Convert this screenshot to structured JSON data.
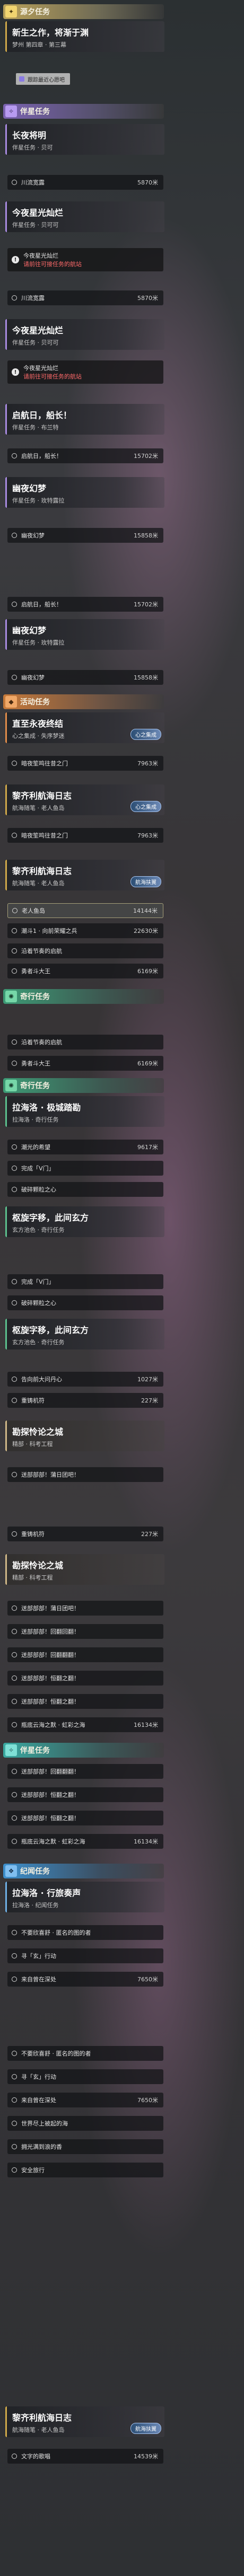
{
  "sections": {
    "s1": "源夕任务",
    "s2": "伴星任务",
    "s3": "活动任务",
    "s4": "奇行任务",
    "s5": "奇行任务",
    "s6": "伴星任务",
    "s7": "伴星任务",
    "s8": "纪闻任务"
  },
  "q1": {
    "title": "新生之作，将渐于渊",
    "sub": "梦州 第四章 · 第三幕",
    "hint": "跟踪最近心愿吧"
  },
  "q2": {
    "title": "长夜将明",
    "sub": "伴星任务 · 贝可"
  },
  "q2o": {
    "text": "川流宽露",
    "dist": "5870米"
  },
  "q3": {
    "title": "今夜星光灿烂",
    "sub": "伴星任务 · 贝可可"
  },
  "q3n": {
    "warn": "!",
    "line1": "今夜星光灿烂",
    "line2": "请前往可接任务的航站"
  },
  "q3o": {
    "text": "川流宽露",
    "dist": "5870米"
  },
  "q4": {
    "title": "今夜星光灿烂",
    "sub": "伴星任务 · 贝可可"
  },
  "q4n": {
    "warn": "!",
    "line1": "今夜星光灿烂",
    "line2": "请前往可接任务的航站"
  },
  "q5": {
    "title": "启航日，船长！",
    "sub": "伴星任务 · 布兰特"
  },
  "q5o": {
    "text": "启航日，船长！",
    "dist": "15702米"
  },
  "q6": {
    "title": "幽夜幻梦",
    "sub": "伴星任务 · 玫特露拉"
  },
  "q6o": {
    "text": "幽夜幻梦",
    "dist": "15858米"
  },
  "q7o": {
    "text": "启航日，船长！",
    "dist": "15702米"
  },
  "q8": {
    "title": "幽夜幻梦",
    "sub": "伴星任务 · 玫特露拉"
  },
  "q8o": {
    "text": "幽夜幻梦",
    "dist": "15858米"
  },
  "q9": {
    "title": "直至永夜终结",
    "sub": "心之集成 · 失序梦迷",
    "badge": "心之集成"
  },
  "q9o": {
    "text": "暗夜笙鸣往昔之门",
    "dist": "7963米"
  },
  "q10": {
    "title": "黎齐利航海日志",
    "sub": "航海随笔 · 老人鱼岛",
    "badge": "心之集成"
  },
  "q10o": {
    "text": "暗夜笙鸣往昔之门",
    "dist": "7963米"
  },
  "q11": {
    "title": "黎齐利航海日志",
    "sub": "航海随笔 · 老人鱼岛",
    "badge": "航海扶翼"
  },
  "q11o1": {
    "text": "老人鱼岛",
    "dist": "14144米"
  },
  "q11o2": {
    "text": "潮斗1 · 向前荣耀之兵",
    "dist": "22630米"
  },
  "q11o3": {
    "text": "沿着节奏的启航",
    "dist": ""
  },
  "q11o4": {
    "text": "勇者斗大王",
    "dist": "6169米"
  },
  "q12o1": {
    "text": "沿着节奏的启航",
    "dist": ""
  },
  "q12o2": {
    "text": "勇者斗大王",
    "dist": "6169米"
  },
  "q13": {
    "title": "拉海洛 · 极城踏勘",
    "sub": "拉海洛 · 奇行任务"
  },
  "q13o1": {
    "text": "潮光的希望",
    "dist": "9617米"
  },
  "q13o2": {
    "text": "完成「V门」",
    "dist": ""
  },
  "q13o3": {
    "text": "破碎颗粒之心",
    "dist": ""
  },
  "q14": {
    "title": "枢旋字移，此间玄方",
    "sub": "玄方池色 · 奇行任务"
  },
  "q14o1": {
    "text": "完成「V门」",
    "dist": ""
  },
  "q14o2": {
    "text": "破碎颗粒之心",
    "dist": ""
  },
  "q15": {
    "title": "枢旋字移，此间玄方",
    "sub": "玄方池色 · 奇行任务"
  },
  "q15o1": {
    "text": "告向前大问丹心",
    "dist": "1027米"
  },
  "q15o2": {
    "text": "重铸机符",
    "dist": "227米"
  },
  "q16": {
    "title": "勘探怜论之城",
    "sub": "精部 · 科考工程"
  },
  "q16o1": {
    "text": "送部部部！蒲日团吧！",
    "dist": ""
  },
  "q16o2": {
    "text": "重铸机符",
    "dist": "227米"
  },
  "q17": {
    "title": "勘探怜论之城",
    "sub": "精部 · 科考工程"
  },
  "q17o1": {
    "text": "送部部部！蒲日团吧！",
    "dist": ""
  },
  "q17o2": {
    "text": "送部部部！回翻回翻！",
    "dist": ""
  },
  "q17o3": {
    "text": "送部部部！回翻翻翻！",
    "dist": ""
  },
  "q17o4": {
    "text": "送部部部！恒翻之翻！",
    "dist": ""
  },
  "q17o5": {
    "text": "送部部部！恒翻之翻！",
    "dist": ""
  },
  "q17o6": {
    "text": "瓶底云海之默 · 虹彩之海",
    "dist": "16134米"
  },
  "q18o1": {
    "text": "送部部部！回翻翻翻！",
    "dist": ""
  },
  "q18o2": {
    "text": "送部部部！恒翻之翻！",
    "dist": ""
  },
  "q18o3": {
    "text": "送部部部！恒翻之翻！",
    "dist": ""
  },
  "q18o4": {
    "text": "瓶底云海之默 · 虹彩之海",
    "dist": "16134米"
  },
  "q19": {
    "title": "拉海洛 · 行旅奏声",
    "sub": "拉海洛 · 纪闻任务"
  },
  "q19o1": {
    "text": "不要欣喜舒 · 匿名的图的者",
    "dist": ""
  },
  "q19o2": {
    "text": "寻「玄」行动",
    "dist": ""
  },
  "q19o3": {
    "text": "来自曾在深处",
    "dist": "7650米"
  },
  "q20o1": {
    "text": "不要欣喜舒 · 匿名的图的者",
    "dist": ""
  },
  "q20o2": {
    "text": "寻「玄」行动",
    "dist": ""
  },
  "q20o3": {
    "text": "来自曾在深处",
    "dist": "7650米"
  },
  "q20o4": {
    "text": "世界尽上被起的海",
    "dist": ""
  },
  "q20o5": {
    "text": "拥光满到浪的香",
    "dist": ""
  },
  "q20o6": {
    "text": "安全旅行",
    "dist": ""
  },
  "q21": {
    "title": "黎齐利航海日志",
    "sub": "航海随笔 · 老人鱼岛",
    "badge": "航海扶翼"
  },
  "q21o1": {
    "text": "文字的歌唱",
    "dist": "14539米"
  }
}
